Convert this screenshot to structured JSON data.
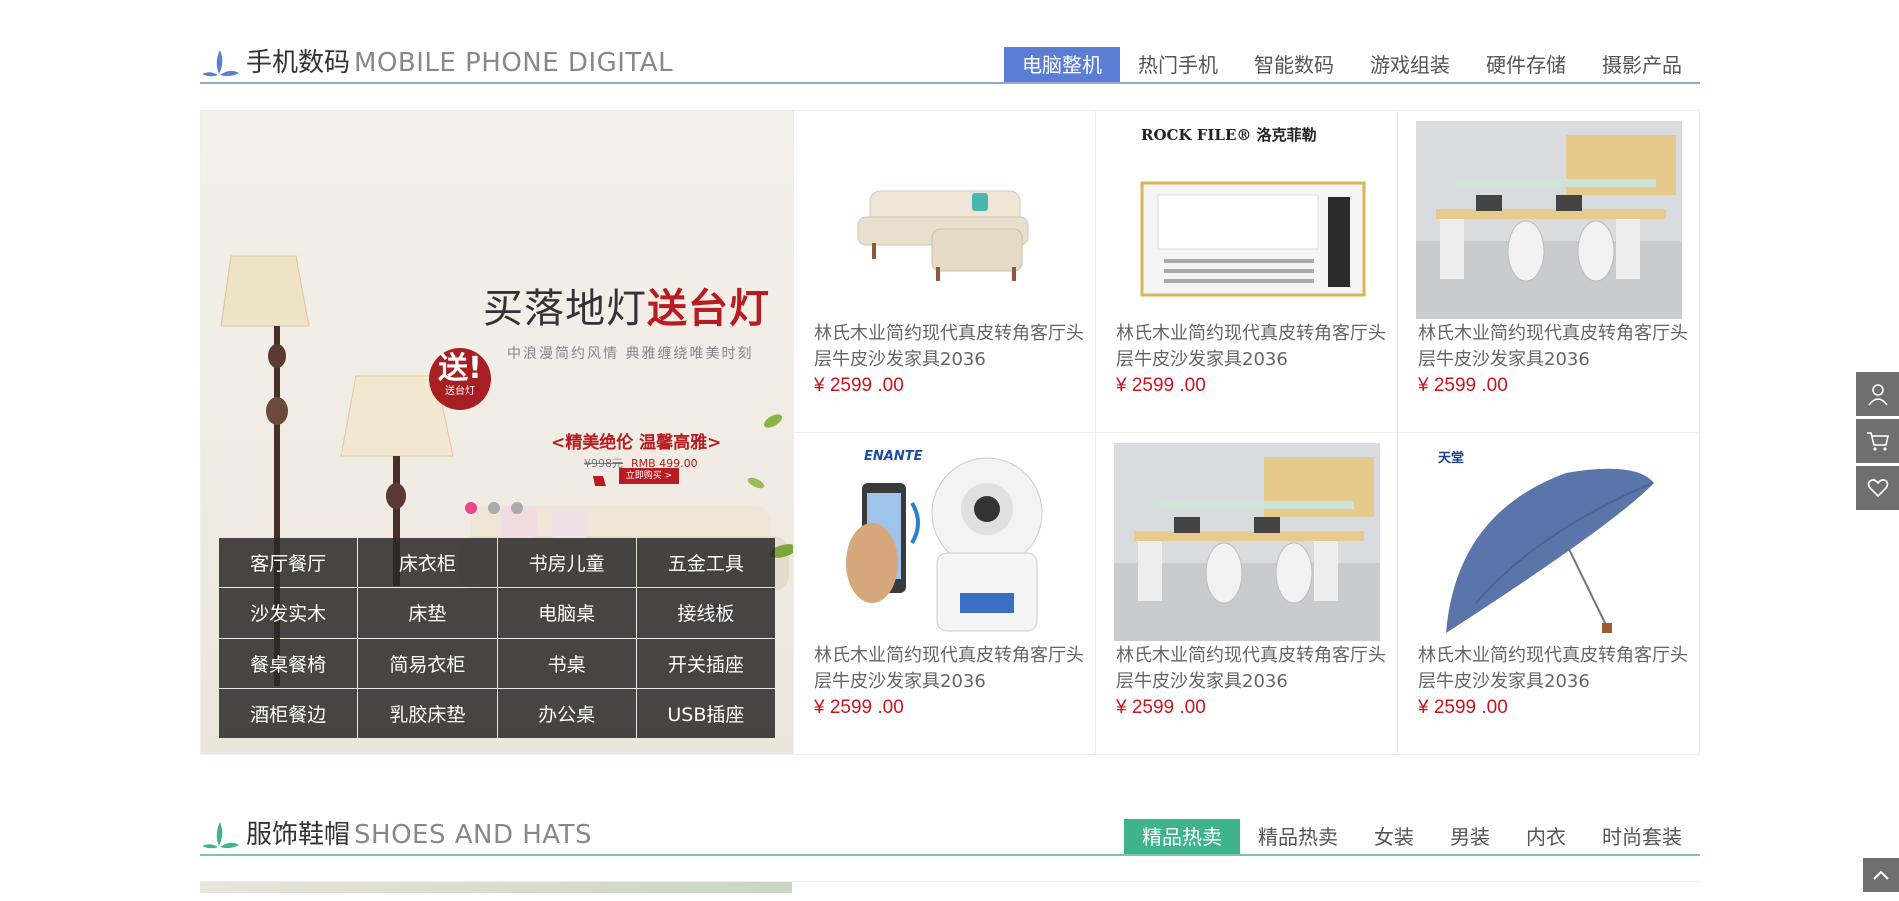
{
  "colors": {
    "section1_accent": "#5b7ed4",
    "section1_underline": "#8fa9cf",
    "section2_accent": "#3fb48c",
    "section2_underline": "#7cc7aa",
    "price_red": "#c8161d"
  },
  "section1": {
    "title_cn": "手机数码",
    "title_en": "MOBILE PHONE DIGITAL",
    "tabs": [
      "电脑整机",
      "热门手机",
      "智能数码",
      "游戏组装",
      "硬件存储",
      "摄影产品"
    ],
    "active_tab": "电脑整机",
    "banner": {
      "headline_part1": "买落地灯",
      "headline_part2": "送台灯",
      "subline": "中浪漫简约风情  典雅缠绕唯美时刻",
      "gift_big": "送!",
      "gift_small": "送台灯",
      "promo": "<精美绝伦 温馨高雅>",
      "old_price": "¥998元",
      "new_price": "RMB 499.00",
      "buy_label": "立即购买 >",
      "slide_count": 3,
      "active_slide": 1
    },
    "categories": [
      "客厅餐厅",
      "床衣柜",
      "书房儿童",
      "五金工具",
      "沙发实木",
      "床垫",
      "电脑桌",
      "接线板",
      "餐桌餐椅",
      "简易衣柜",
      "书桌",
      "开关插座",
      "酒柜餐边",
      "乳胶床垫",
      "办公桌",
      "USB插座"
    ],
    "products": [
      {
        "image": "sofa-image",
        "name": "林氏木业简约现代真皮转角客厅头层牛皮沙发家具2036",
        "price": "¥ 2599 .00"
      },
      {
        "image": "bathroom-heater-image",
        "brand": "ROCK FILE® 洛克菲勒",
        "name": "林氏木业简约现代真皮转角客厅头层牛皮沙发家具2036",
        "price": "¥ 2599 .00"
      },
      {
        "image": "office-desk-image",
        "name": "林氏木业简约现代真皮转角客厅头层牛皮沙发家具2036",
        "price": "¥ 2599 .00"
      },
      {
        "image": "ip-camera-image",
        "brand": "ENANTE",
        "name": "林氏木业简约现代真皮转角客厅头层牛皮沙发家具2036",
        "price": "¥ 2599 .00"
      },
      {
        "image": "office-desk-image",
        "name": "林氏木业简约现代真皮转角客厅头层牛皮沙发家具2036",
        "price": "¥ 2599 .00"
      },
      {
        "image": "umbrella-image",
        "brand": "天堂",
        "name": "林氏木业简约现代真皮转角客厅头层牛皮沙发家具2036",
        "price": "¥ 2599 .00"
      }
    ]
  },
  "section2": {
    "title_cn": "服饰鞋帽",
    "title_en": "SHOES AND HATS",
    "tabs": [
      "精品热卖",
      "精品热卖",
      "女装",
      "男装",
      "内衣",
      "时尚套装"
    ],
    "active_tab_index": 0
  },
  "side_bar": [
    "user-icon",
    "cart-icon",
    "heart-icon"
  ],
  "back_to_top": "chevron-up-icon"
}
